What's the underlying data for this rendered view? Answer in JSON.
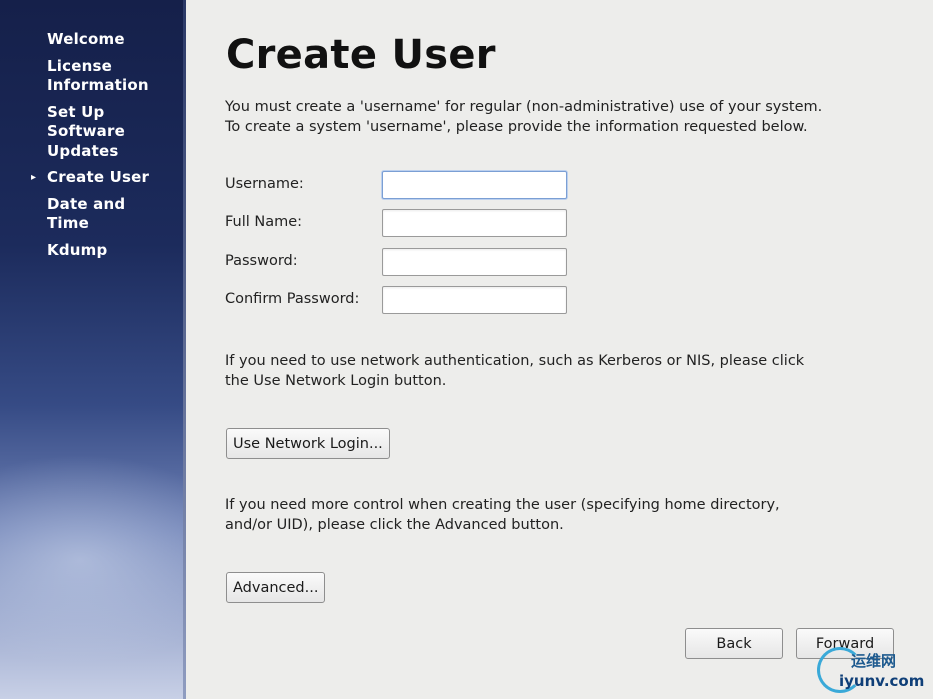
{
  "sidebar": {
    "items": [
      {
        "label": "Welcome",
        "current": false
      },
      {
        "label": "License Information",
        "current": false
      },
      {
        "label": "Set Up Software Updates",
        "current": false
      },
      {
        "label": "Create User",
        "current": true
      },
      {
        "label": "Date and Time",
        "current": false
      },
      {
        "label": "Kdump",
        "current": false
      }
    ],
    "current_marker": "▸"
  },
  "main": {
    "title": "Create User",
    "intro": "You must create a 'username' for regular (non-administrative) use of your system.  To create a system 'username', please provide the information requested below.",
    "fields": {
      "username": {
        "label": "Username:",
        "value": ""
      },
      "full_name": {
        "label": "Full Name:",
        "value": ""
      },
      "password": {
        "label": "Password:",
        "value": ""
      },
      "confirm_password": {
        "label": "Confirm Password:",
        "value": ""
      }
    },
    "network_text": "If you need to use network authentication, such as Kerberos or NIS, please click the Use Network Login button.",
    "network_button": "Use Network Login...",
    "advanced_text": "If you need more control when creating the user (specifying home directory, and/or UID), please click the Advanced button.",
    "advanced_button": "Advanced...",
    "back_button": "Back",
    "forward_button": "Forward"
  },
  "watermark": {
    "top": "运维网",
    "bottom": "iyunv.com",
    "color": "#3aa9d8"
  },
  "colors": {
    "sidebar_dark": "#15204a",
    "sidebar_light": "#c8d0e6",
    "panel_bg": "#ededeb"
  }
}
